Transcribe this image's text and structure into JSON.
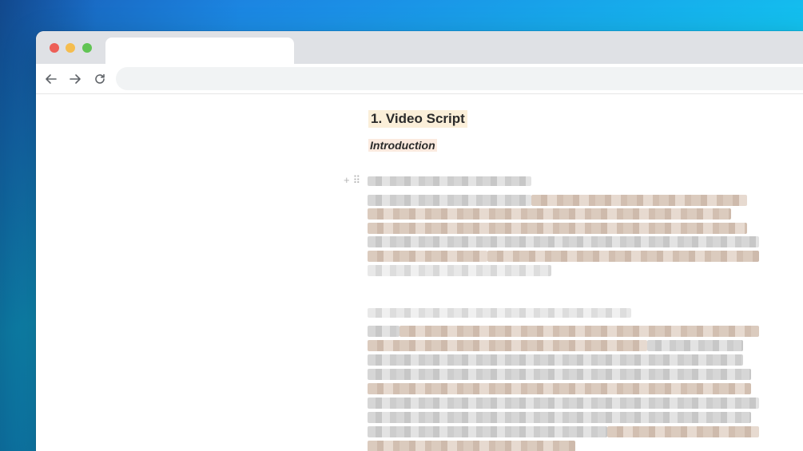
{
  "document": {
    "heading": "1. Video Script",
    "subheading": "Introduction"
  },
  "browser": {
    "icons": {
      "back": "arrow-left-icon",
      "forward": "arrow-right-icon",
      "reload": "reload-icon"
    },
    "traffic_lights": {
      "close": "#ed5f57",
      "minimize": "#f5bd4f",
      "zoom": "#61c454"
    }
  },
  "block_controls": {
    "add_icon": "plus-icon",
    "drag_icon": "drag-handle-icon"
  }
}
